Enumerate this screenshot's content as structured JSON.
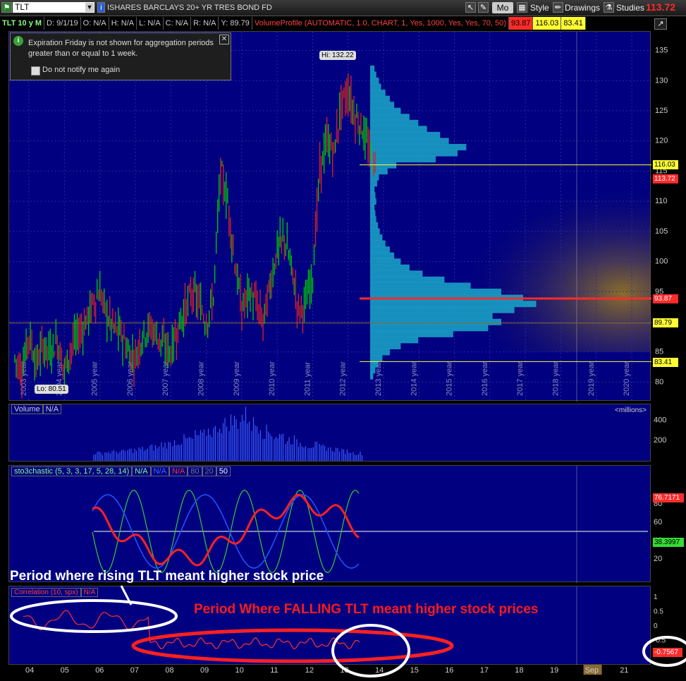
{
  "toolbar": {
    "symbol": "TLT",
    "instrument_name": "ISHARES BARCLAYS 20+ YR TRES BOND FD",
    "mode_label": "Mo",
    "style_label": "Style",
    "drawings_label": "Drawings",
    "studies_label": "Studies",
    "last_price": "113.72"
  },
  "infobar": {
    "chart_id": "TLT 10 y M",
    "date": "D: 9/1/19",
    "open": "O: N/A",
    "high": "H: N/A",
    "low": "L: N/A",
    "close": "C: N/A",
    "range": "R: N/A",
    "y": "Y: 89.79",
    "vp_label": "VolumeProfile (AUTOMATIC, 1.0, CHART, 1, Yes, 1000, Yes, Yes, 70, 50)",
    "vp_v1": "93.87",
    "vp_v2": "116.03",
    "vp_v3": "83.41"
  },
  "notice": {
    "message": "Expiration Friday is not shown for aggregation periods greater than or equal to 1 week.",
    "checkbox_label": "Do not notify me again"
  },
  "price_badges": {
    "b116": "116.03",
    "b113": "113.72",
    "b93": "93.87",
    "b89": "89.79",
    "b83": "83.41"
  },
  "hi_label": "Hi: 132.22",
  "lo_label": "Lo: 80.51",
  "volume": {
    "label": "Volume",
    "value": "N/A",
    "units": "<millions>"
  },
  "stoch": {
    "label": "sto3chastic (5, 3, 3, 17, 5, 28, 14)",
    "v1": "N/A",
    "v2": "N/A",
    "v3": "N/A",
    "v4": "80",
    "v5": "20",
    "v6": "50",
    "badge_red": "76.7171",
    "badge_green": "38.3997"
  },
  "corr": {
    "label": "Correlation (10, spx)",
    "value": "N/A",
    "badge": "-0.7567"
  },
  "annotations": {
    "white_text": "Period where rising TLT meant higher stock price",
    "red_text": "Period Where FALLING TLT meant higher stock prices"
  },
  "colors": {
    "panel_bg": "#000080",
    "up_bar": "#00cc00",
    "down_bar": "#dd2222",
    "profile": "#1a9fc4",
    "stoch_fast": "#33cc33",
    "stoch_slow": "#ff2020",
    "stoch_k": "#2050ff"
  },
  "chart_data": {
    "type": "candlestick",
    "title": "ISHARES BARCLAYS 20+ YR TRES BOND FD",
    "price_ticks": [
      80,
      85,
      90,
      95,
      100,
      105,
      110,
      115,
      120,
      125,
      130,
      135
    ],
    "ylim": [
      79,
      136
    ],
    "year_labels": [
      "2003 year",
      "2004 year",
      "2005 year",
      "2006 year",
      "2007 year",
      "2008 year",
      "2009 year",
      "2010 year",
      "2011 year",
      "2012 year",
      "2013 year",
      "2014 year",
      "2015 year",
      "2016 year",
      "2017 year",
      "2018 year",
      "2019 year",
      "2020 year"
    ],
    "close_path": [
      [
        2003.0,
        84
      ],
      [
        2003.2,
        82
      ],
      [
        2003.4,
        88
      ],
      [
        2003.6,
        83
      ],
      [
        2003.8,
        86
      ],
      [
        2004.0,
        85
      ],
      [
        2004.2,
        87
      ],
      [
        2004.4,
        82
      ],
      [
        2004.6,
        86
      ],
      [
        2004.8,
        88
      ],
      [
        2005.0,
        90
      ],
      [
        2005.2,
        93
      ],
      [
        2005.4,
        95
      ],
      [
        2005.6,
        91
      ],
      [
        2005.8,
        89
      ],
      [
        2006.0,
        88
      ],
      [
        2006.2,
        85
      ],
      [
        2006.4,
        84
      ],
      [
        2006.6,
        88
      ],
      [
        2006.8,
        89
      ],
      [
        2007.0,
        88
      ],
      [
        2007.2,
        86
      ],
      [
        2007.4,
        85
      ],
      [
        2007.6,
        89
      ],
      [
        2007.8,
        92
      ],
      [
        2008.0,
        95
      ],
      [
        2008.2,
        93
      ],
      [
        2008.4,
        90
      ],
      [
        2008.6,
        94
      ],
      [
        2008.8,
        115
      ],
      [
        2009.0,
        110
      ],
      [
        2009.2,
        100
      ],
      [
        2009.4,
        92
      ],
      [
        2009.6,
        95
      ],
      [
        2009.8,
        93
      ],
      [
        2010.0,
        90
      ],
      [
        2010.2,
        96
      ],
      [
        2010.4,
        102
      ],
      [
        2010.6,
        104
      ],
      [
        2010.8,
        99
      ],
      [
        2011.0,
        92
      ],
      [
        2011.2,
        93
      ],
      [
        2011.4,
        98
      ],
      [
        2011.6,
        115
      ],
      [
        2011.8,
        120
      ],
      [
        2012.0,
        118
      ],
      [
        2012.2,
        126
      ],
      [
        2012.4,
        128
      ],
      [
        2012.6,
        124
      ],
      [
        2012.8,
        122
      ],
      [
        2013.0,
        118
      ],
      [
        2013.2,
        115
      ]
    ],
    "volume_values": [
      80,
      90,
      95,
      110,
      120,
      140,
      170,
      200,
      220,
      260,
      310,
      370,
      410,
      460,
      380,
      300,
      260,
      220,
      180,
      160,
      140,
      120,
      100,
      80
    ],
    "volume_ticks": [
      200,
      400
    ],
    "stoch_ticks": [
      20,
      40,
      60,
      80
    ],
    "corr_ticks": [
      -0.5,
      0,
      0.5,
      1
    ],
    "month_axis": [
      "04",
      "05",
      "06",
      "07",
      "08",
      "09",
      "10",
      "11",
      "12",
      "13",
      "14",
      "15",
      "16",
      "17",
      "18",
      "19",
      "Sep",
      "21"
    ],
    "volume_profile": [
      [
        81,
        7
      ],
      [
        82,
        12
      ],
      [
        83,
        18
      ],
      [
        84,
        28
      ],
      [
        85,
        45
      ],
      [
        86,
        70
      ],
      [
        87,
        110
      ],
      [
        88,
        190
      ],
      [
        89,
        270
      ],
      [
        90,
        300
      ],
      [
        91,
        280
      ],
      [
        92,
        330
      ],
      [
        93,
        380
      ],
      [
        94,
        350
      ],
      [
        95,
        300
      ],
      [
        96,
        230
      ],
      [
        97,
        170
      ],
      [
        98,
        120
      ],
      [
        99,
        90
      ],
      [
        100,
        70
      ],
      [
        101,
        55
      ],
      [
        102,
        45
      ],
      [
        103,
        35
      ],
      [
        104,
        28
      ],
      [
        105,
        22
      ],
      [
        106,
        18
      ],
      [
        107,
        14
      ],
      [
        108,
        12
      ],
      [
        109,
        10
      ],
      [
        110,
        14
      ],
      [
        111,
        12
      ],
      [
        112,
        10
      ],
      [
        113,
        16
      ],
      [
        114,
        20
      ],
      [
        115,
        40
      ],
      [
        116,
        60
      ],
      [
        117,
        150
      ],
      [
        118,
        200
      ],
      [
        119,
        220
      ],
      [
        120,
        180
      ],
      [
        121,
        160
      ],
      [
        122,
        130
      ],
      [
        123,
        110
      ],
      [
        124,
        90
      ],
      [
        125,
        70
      ],
      [
        126,
        55
      ],
      [
        127,
        45
      ],
      [
        128,
        35
      ],
      [
        129,
        25
      ],
      [
        130,
        20
      ],
      [
        131,
        14
      ],
      [
        132,
        10
      ]
    ]
  }
}
